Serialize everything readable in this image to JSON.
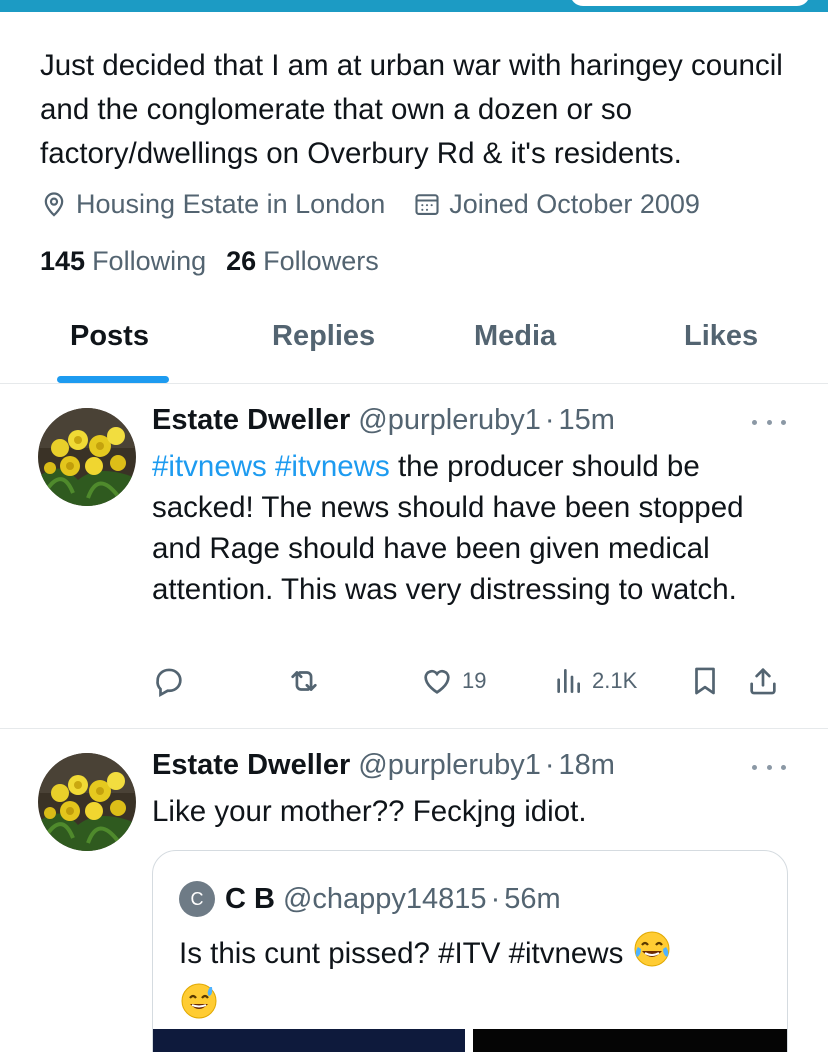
{
  "profile": {
    "bio": "Just decided that I am at urban war with haringey council and the conglomerate that own a dozen or so factory/dwellings on Overbury Rd & it's residents.",
    "location": "Housing Estate in London",
    "joined": "Joined October 2009",
    "following_count": "145",
    "following_label": "Following",
    "followers_count": "26",
    "followers_label": "Followers"
  },
  "tabs": [
    {
      "label": "Posts",
      "active": true
    },
    {
      "label": "Replies",
      "active": false
    },
    {
      "label": "Media",
      "active": false
    },
    {
      "label": "Likes",
      "active": false
    }
  ],
  "posts": [
    {
      "name": "Estate Dweller",
      "handle": "@purpleruby1",
      "separator": "·",
      "time": "15m",
      "hashtag1": "#itvnews",
      "hashtag2": "#itvnews",
      "text": " the producer should be sacked!  The news should have been stopped and Rage should have been given medical attention. This was very distressing to watch.",
      "likes": "19",
      "views": "2.1K"
    },
    {
      "name": "Estate Dweller",
      "handle": "@purpleruby1",
      "separator": "·",
      "time": "18m",
      "text": "Like your mother?? Feckjng idiot.",
      "quote": {
        "avatar_letter": "C",
        "name": "C B",
        "handle": "@chappy14815",
        "separator": "·",
        "time": "56m",
        "text": "Is this cunt pissed? #ITV #itvnews"
      }
    }
  ],
  "colors": {
    "accent": "#1d9bf0",
    "secondary_text": "#536471",
    "banner": "#1c9bc4"
  },
  "icons": [
    "location-icon",
    "calendar-icon",
    "reply-icon",
    "repost-icon",
    "like-icon",
    "views-icon",
    "bookmark-icon",
    "share-icon",
    "more-icon",
    "laughing-tears-emoji",
    "sweat-smile-emoji"
  ]
}
